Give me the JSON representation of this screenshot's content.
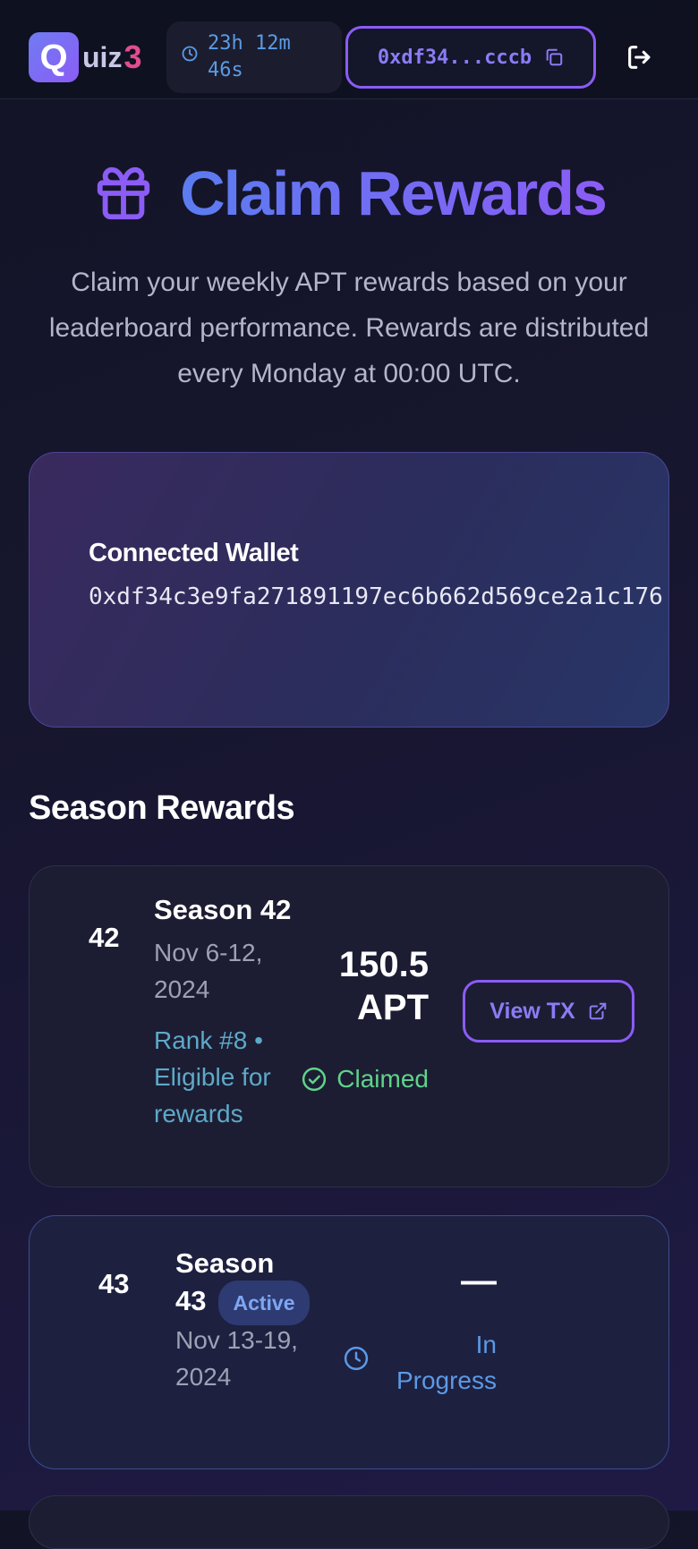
{
  "header": {
    "logo_q": "Q",
    "logo_uiz": "uiz",
    "logo_3": "3",
    "timer_line1": "23h 12m",
    "timer_line2": "46s",
    "wallet_short": "0xdf34...cccb"
  },
  "hero": {
    "title": "Claim Rewards",
    "description": "Claim your weekly APT rewards based on your leaderboard performance. Rewards are distributed every Monday at 00:00 UTC."
  },
  "connected_wallet": {
    "label": "Connected Wallet",
    "address": "0xdf34c3e9fa271891197ec6b662d569ce2a1c176"
  },
  "section_title": "Season Rewards",
  "seasons": [
    {
      "number": "42",
      "title": "Season 42",
      "date_line1": "Nov 6-12,",
      "date_line2": "2024",
      "rank_line1": "Rank #8 •",
      "rank_line2": "Eligible for",
      "rank_line3": "rewards",
      "amount_line1": "150.5",
      "amount_line2": "APT",
      "status": "Claimed",
      "action": "View TX"
    },
    {
      "number": "43",
      "title_line1": "Season",
      "title_line2": "43",
      "badge": "Active",
      "date_line1": "Nov 13-19,",
      "date_line2": "2024",
      "amount": "—",
      "status_line1": "In",
      "status_line2": "Progress"
    }
  ],
  "colors": {
    "accent_purple": "#8b5cf6",
    "accent_blue": "#5b9ae6",
    "claimed_green": "#5fd38a",
    "brand_pink": "#e14d8f"
  }
}
